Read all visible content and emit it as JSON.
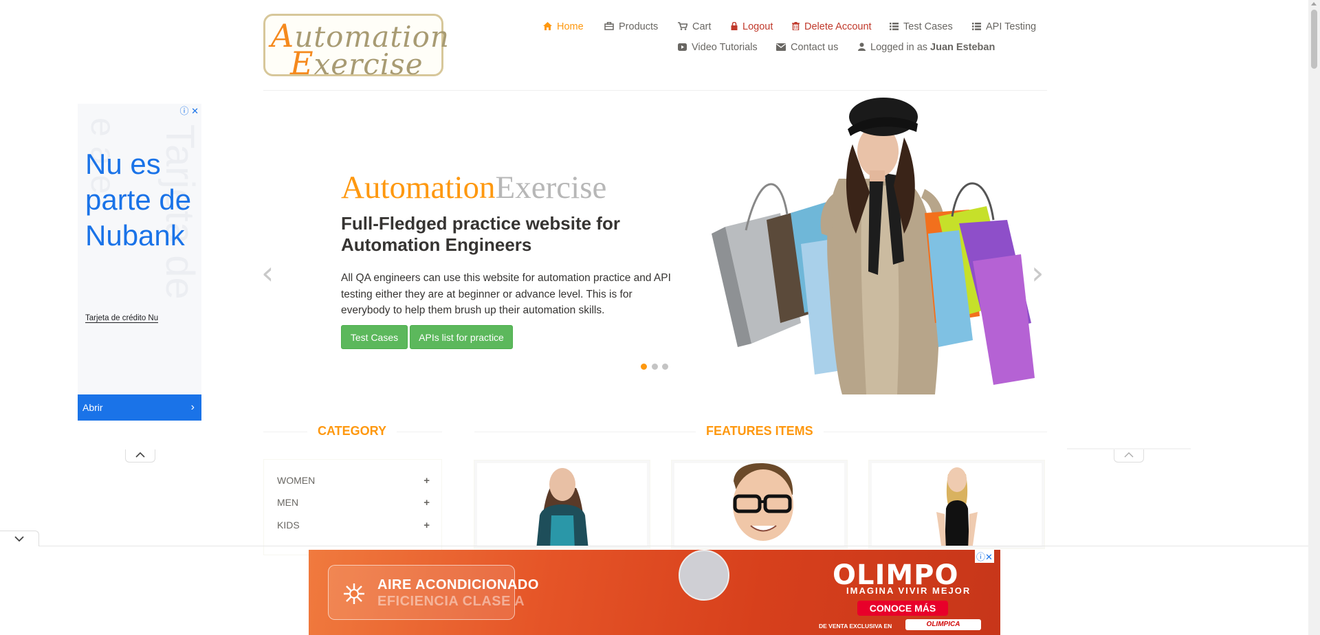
{
  "logo": {
    "line1_cap": "A",
    "line1_rest": "utomation",
    "line2_cap": "E",
    "line2_rest": "xercise"
  },
  "nav": {
    "home": "Home",
    "products": "Products",
    "cart": "Cart",
    "logout": "Logout",
    "delete_account": "Delete Account",
    "test_cases": "Test Cases",
    "api_testing": "API Testing",
    "video_tutorials": "Video Tutorials",
    "contact_us": "Contact us",
    "logged_in_prefix": "Logged in as",
    "logged_in_user": "Juan Esteban"
  },
  "icons": {
    "home": "home-icon",
    "products": "products-icon",
    "cart": "cart-icon",
    "logout": "lock-icon",
    "delete": "trash-icon",
    "test_cases": "list-icon",
    "api_testing": "list-icon",
    "video": "youtube-icon",
    "contact": "envelope-icon",
    "user": "user-icon"
  },
  "colors": {
    "accent": "#fe980f",
    "green": "#5cb85c",
    "danger": "#c0392b",
    "ad_blue": "#1a73e8"
  },
  "hero": {
    "brand_a": "Automation",
    "brand_b": "Exercise",
    "title": "Full-Fledged practice website for Automation Engineers",
    "description": "All QA engineers can use this website for automation practice and API testing either they are at beginner or advance level. This is for everybody to help them brush up their automation skills.",
    "btn_test_cases": "Test Cases",
    "btn_apis": "APIs list for practice",
    "slides_total": 3,
    "slide_active": 1
  },
  "sections": {
    "category": "CATEGORY",
    "features": "FEATURES ITEMS"
  },
  "categories": [
    {
      "label": "WOMEN"
    },
    {
      "label": "MEN"
    },
    {
      "label": "KIDS"
    }
  ],
  "ad_left": {
    "headline": "Nu es parte de Nubank",
    "sub": "Tarjeta de crédito Nu",
    "open_label": "Abrir"
  },
  "ad_bottom": {
    "line1": "AIRE ACONDICIONADO",
    "line2": "EFICIENCIA CLASE A",
    "brand": "OLIMPO",
    "tagline": "IMAGINA VIVIR MEJOR",
    "cta": "CONOCE MÁS",
    "exclusive": "DE VENTA EXCLUSIVA EN",
    "store": "OLIMPICA"
  }
}
